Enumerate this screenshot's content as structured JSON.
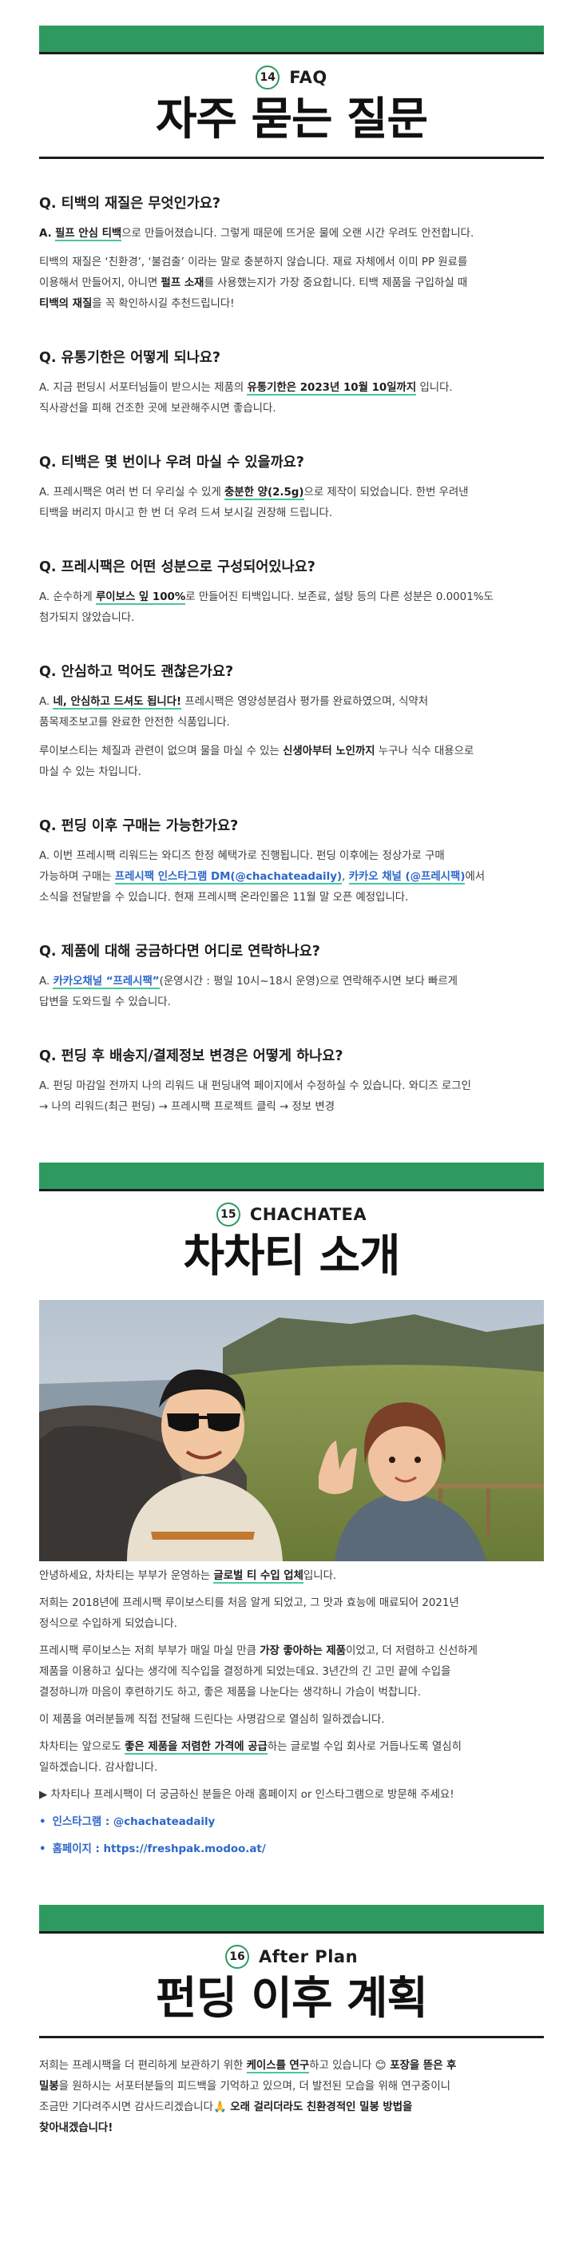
{
  "faq": {
    "number": "14",
    "kicker": "FAQ",
    "title": "자주 묻는 질문",
    "q1": {
      "question": "Q. 티백의 재질은 무엇인가요?",
      "a_prefix": "A.",
      "a_hl": "필프 안심 티백",
      "a_rest": "으로 만들어졌습니다. 그렇게 때문에 뜨거운 물에 오랜 시간 우려도 안전합니다.",
      "p2_1": "티백의 재질은 ‘친환경’, ‘불검출’ 이라는 말로 충분하지 않습니다. 재료 자체에서 이미 PP 원료를",
      "p2_2a": "이용해서 만들어지, 아니면 ",
      "p2_2b": "펄프 소재",
      "p2_2c": "를 사용했는지가 가장 중요합니다. 티백 제품을 구입하실 때",
      "p2_3a": "티백의 재질",
      "p2_3b": "을 꼭 확인하시길 추천드립니다!"
    },
    "q2": {
      "question": "Q. 유통기한은 어떻게 되나요?",
      "a1a": "A. 지금 펀딩시 서포터님들이 받으시는 제품의 ",
      "a1b": "유통기한은 2023년 10월 10일까지",
      "a1c": " 입니다.",
      "a2": "직사광선을 피해 건조한 곳에 보관해주시면 좋습니다."
    },
    "q3": {
      "question": "Q.  티백은 몇 번이나 우려 마실 수 있을까요?",
      "a1a": "A.  프레시팩은 여러 번 더 우리실 수 있게 ",
      "a1b": "충분한 양(2.5g)",
      "a1c": "으로 제작이 되었습니다. 한번 우려낸",
      "a2": "티백을 버리지 마시고 한 번 더 우려 드셔 보시길 권장해 드립니다."
    },
    "q4": {
      "question": "Q. 프레시팩은 어떤 성분으로 구성되어있나요?",
      "a1a": "A. 순수하게 ",
      "a1b": "루이보스 잎 100%",
      "a1c": "로 만들어진 티백입니다. 보존료, 설탕 등의 다른 성분은 0.0001%도",
      "a2": "첨가되지 않았습니다."
    },
    "q5": {
      "question": "Q. 안심하고 먹어도 괜찮은가요?",
      "a1a": "A. ",
      "a1b": "네, 안심하고 드셔도 됩니다!",
      "a1c": " 프레시팩은 영양성분검사 평가를 완료하였으며, 식약처",
      "a2": "품목제조보고를 완료한 안전한 식품입니다.",
      "p2_1a": "루이보스티는 체질과 관련이 없으며 물을 마실 수 있는 ",
      "p2_1b": "신생아부터 노인까지",
      "p2_1c": " 누구나 식수 대용으로",
      "p2_2": "마실 수 있는 차입니다."
    },
    "q6": {
      "question": "Q.  펀딩 이후 구매는 가능한가요?",
      "a1": "A.  이번 프레시팩 리워드는 와디즈 한정 혜택가로 진행됩니다. 펀딩 이후에는 정상가로 구매",
      "a2a": "가능하며 구매는 ",
      "a2b": "프레시팩 인스타그램 DM(@chachateadaily)",
      "a2c": ", ",
      "a2d": "카카오 채널 (@프레시팩)",
      "a2e": "에서",
      "a3": "소식을 전달받을 수 있습니다. 현재 프레시팩 온라인몰은 11월 말 오픈 예정입니다."
    },
    "q7": {
      "question": "Q. 제품에 대해 궁금하다면 어디로 연락하나요?",
      "a1a": "A. ",
      "a1b": "카카오채널 “프레시팩”",
      "a1c": "(운영시간 : 평일 10시~18시 운영)으로 연락해주시면 보다 빠르게",
      "a2": "답변을 도와드릴 수 있습니다."
    },
    "q8": {
      "question": "Q. 펀딩 후 배송지/결제정보 변경은 어떻게 하나요?",
      "a1": "A. 펀딩 마감일 전까지 나의 리워드 내 펀딩내역 페이지에서 수정하실 수 있습니다. 와디즈 로그인",
      "a2": "→ 나의 리워드(최근 펀딩) → 프레시팩 프로젝트 클릭 → 정보 변경"
    }
  },
  "about": {
    "number": "15",
    "kicker": "CHACHATEA",
    "title": "차차티 소개",
    "photo_alt": "couple selfie at seaside",
    "p1a": "안녕하세요, 차차티는 부부가 운영하는 ",
    "p1b": "글로벌 티 수입 업체",
    "p1c": "입니다.",
    "p2_1": "저희는 2018년에 프레시팩 루이보스티를 처음 알게 되었고, 그 맛과 효능에 매료되어 2021년",
    "p2_2": "정식으로 수입하게 되었습니다.",
    "p3_1a": "프레시팩 루이보스는 저희 부부가 매일 마실 만큼 ",
    "p3_1b": "가장 좋아하는 제품",
    "p3_1c": "이었고, 더 저렴하고 신선하게",
    "p3_2": "제품을 이용하고 싶다는 생각에 직수입을 결정하게 되었는데요. 3년간의 긴 고민 끝에 수입을",
    "p3_3": "결정하니까 마음이 후련하기도 하고, 좋은 제품을 나눈다는 생각하니 가슴이 벅찹니다.",
    "p4": "이 제품을 여러분들께 직접 전달해 드린다는 사명감으로 열심히 일하겠습니다.",
    "p5_1a": "차차티는 앞으로도 ",
    "p5_1b": "좋은 제품을 저렴한 가격에 공급",
    "p5_1c": "하는 글로벌 수입 회사로 거듭나도록 열심히",
    "p5_2": "일하겠습니다. 감사합니다.",
    "p6": "▶ 차차티나 프레시팩이 더 궁금하신 분들은 아래 홈페이지 or 인스타그램으로 방문해 주세요!",
    "bullet1": "인스타그램 : @chachateadaily",
    "bullet2": "홈페이지 : https://freshpak.modoo.at/"
  },
  "plan": {
    "number": "16",
    "kicker": "After Plan",
    "title": "펀딩 이후 계획",
    "p1_1a": "저희는 프레시팩을 더 편리하게 보관하기 위한 ",
    "p1_1b": "케이스를 연구",
    "p1_1c": "하고 있습니다 ",
    "p1_1emoji": "😊",
    "p1_1d": " 포장을 뜯은 후",
    "p1_2a": "밀봉",
    "p1_2b": "을 원하시는 서포터분들의 피드백을 기억하고 있으며, 더 발전된 모습을 위해 연구중이니",
    "p1_3a": "조금만 기다려주시면 감사드리겠습니다",
    "p1_3emoji": "🙏",
    "p1_3b": " 오래 걸리더라도 친환경적인 밀봉 방법을",
    "p1_4": "찾아내겠습니다!"
  },
  "colors": {
    "accent_green": "#2f9a5f",
    "underline_mint": "#48c79a",
    "link_blue": "#2d67c9"
  }
}
